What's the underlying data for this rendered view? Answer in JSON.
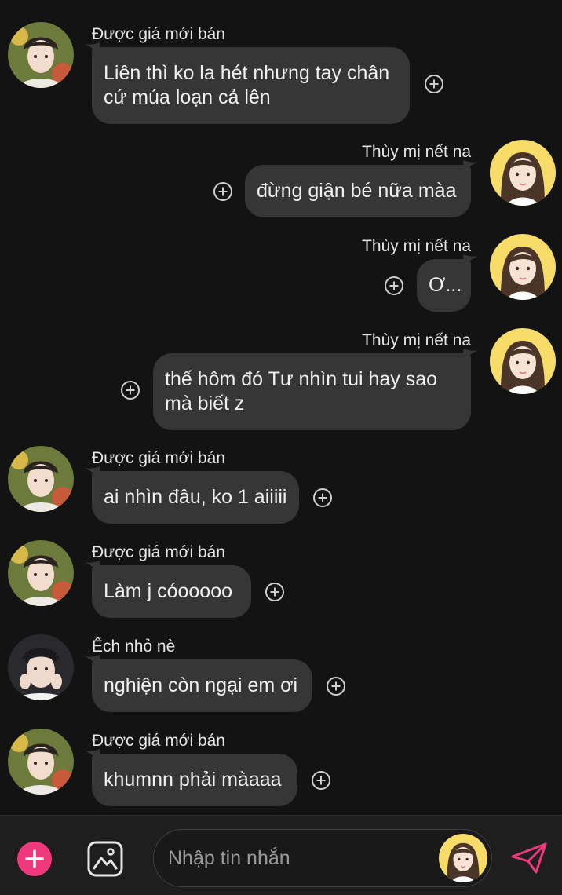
{
  "messages": [
    {
      "side": "left",
      "sender": "Được giá mới bán",
      "avatar": "avatar-boy",
      "lines": [
        "Liên thì ko la hét nhưng tay chân",
        "cứ múa loạn cả lên"
      ]
    },
    {
      "side": "right",
      "sender": "Thùy mị nết na",
      "avatar": "avatar-girl",
      "lines": [
        "đừng giận bé nữa màa"
      ]
    },
    {
      "side": "right",
      "sender": "Thùy mị nết na",
      "avatar": "avatar-girl",
      "lines": [
        "Ơ..."
      ]
    },
    {
      "side": "right",
      "sender": "Thùy mị nết na",
      "avatar": "avatar-girl",
      "lines": [
        "thế hôm đó Tư nhìn tui hay sao",
        "mà biết z"
      ]
    },
    {
      "side": "left",
      "sender": "Được giá mới bán",
      "avatar": "avatar-boy",
      "lines": [
        "ai nhìn đâu, ko 1 aiiiii"
      ]
    },
    {
      "side": "left",
      "sender": "Được giá mới bán",
      "avatar": "avatar-boy",
      "lines": [
        "Làm j cóooooo"
      ]
    },
    {
      "side": "left",
      "sender": "Ếch nhỏ nè",
      "avatar": "avatar-man",
      "lines": [
        "nghiện còn ngại em ơi"
      ]
    },
    {
      "side": "left",
      "sender": "Được giá mới bán",
      "avatar": "avatar-boy",
      "lines": [
        "khumnn phải màaaa"
      ]
    }
  ],
  "input": {
    "placeholder": "Nhập tin nhắn"
  },
  "icons": {
    "add": "plus-circle-icon",
    "image": "image-icon",
    "send": "send-icon",
    "reaction": "add-reaction-icon"
  },
  "colors": {
    "background": "#131313",
    "bubble": "#363636",
    "accent": "#f0387c"
  }
}
